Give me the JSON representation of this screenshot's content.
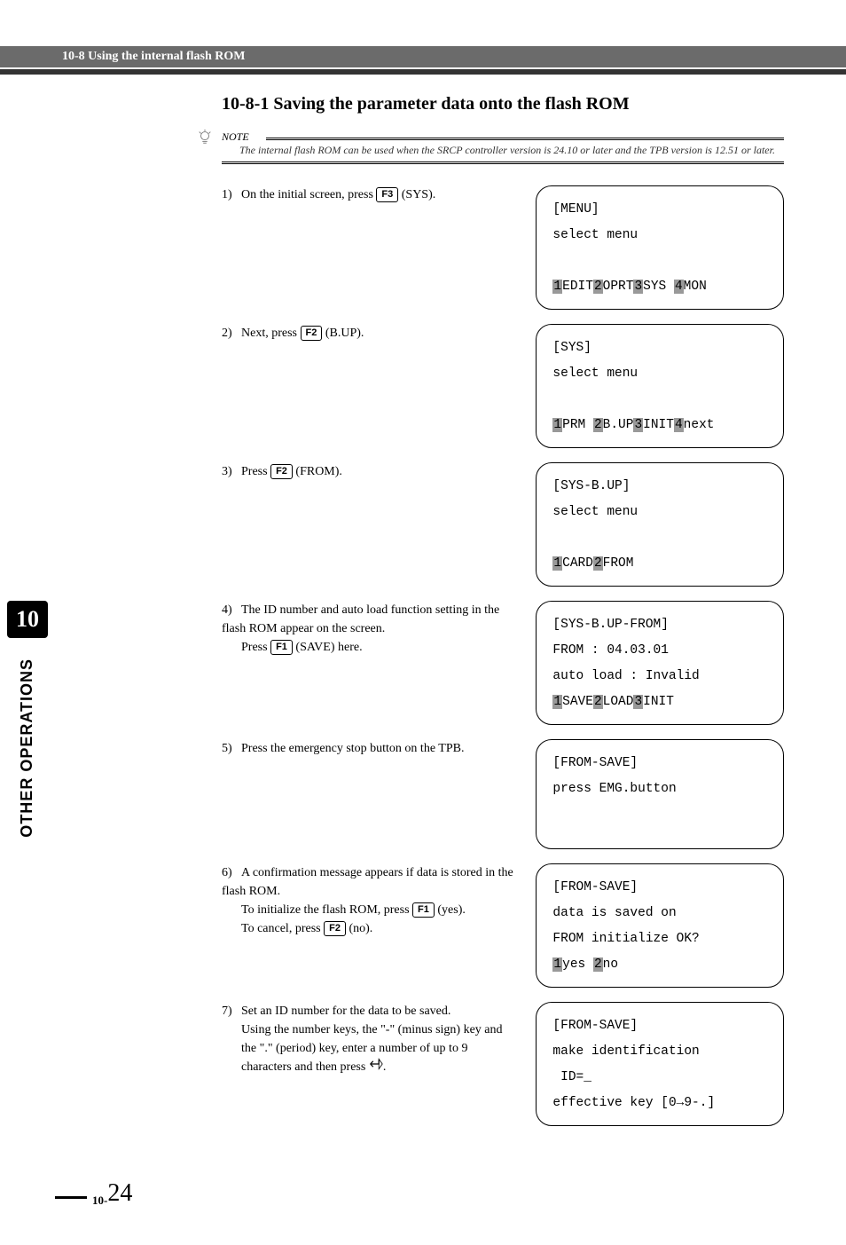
{
  "header": {
    "breadcrumb": "10-8 Using the internal flash ROM"
  },
  "section": {
    "title": "10-8-1 Saving the parameter data onto the flash ROM"
  },
  "note": {
    "label": "NOTE",
    "text": "The internal flash ROM can be used when the SRCP controller version is 24.10 or later and the TPB version is 12.51 or later."
  },
  "steps": [
    {
      "n": "1)",
      "before": "On the initial screen, press ",
      "key": "F3",
      "after": " (SYS)."
    },
    {
      "n": "2)",
      "before": "Next, press ",
      "key": "F2",
      "after": " (B.UP)."
    },
    {
      "n": "3)",
      "before": "Press ",
      "key": "F2",
      "after": " (FROM)."
    },
    {
      "n": "4)",
      "text_a": "The ID number and auto load function setting in the flash ROM appear on the screen.",
      "text_b_before": "Press ",
      "key": "F1",
      "text_b_after": " (SAVE) here."
    },
    {
      "n": "5)",
      "plain": "Press the emergency stop button on the TPB."
    },
    {
      "n": "6)",
      "line1": "A confirmation message appears if data is stored in the flash ROM.",
      "line2_before": "To initialize the flash ROM, press ",
      "key2": "F1",
      "line2_after": " (yes).",
      "line3_before": "To cancel, press ",
      "key3": "F2",
      "line3_after": " (no)."
    },
    {
      "n": "7)",
      "line1": "Set an ID number for the data to be saved.",
      "line2": "Using the number keys, the \"-\" (minus sign) key and the \".\" (period) key, enter a number of up to 9 characters and then press ",
      "enter_icon": true,
      "line2_after": "."
    }
  ],
  "screens": [
    {
      "title": "[MENU]",
      "sub": "select menu",
      "menu": [
        {
          "k": "1",
          "t": "EDIT"
        },
        {
          "k": "2",
          "t": "OPRT"
        },
        {
          "k": "3",
          "t": "SYS "
        },
        {
          "k": "4",
          "t": "MON"
        }
      ]
    },
    {
      "title": "[SYS]",
      "sub": "select menu",
      "menu": [
        {
          "k": "1",
          "t": "PRM "
        },
        {
          "k": "2",
          "t": "B.UP"
        },
        {
          "k": "3",
          "t": "INIT"
        },
        {
          "k": "4",
          "t": "next"
        }
      ]
    },
    {
      "title": "[SYS-B.UP]",
      "sub": "select menu",
      "menu": [
        {
          "k": "1",
          "t": "CARD"
        },
        {
          "k": "2",
          "t": "FROM"
        }
      ]
    },
    {
      "title": "[SYS-B.UP-FROM]",
      "l2": "FROM : 04.03.01",
      "l3": "auto load : Invalid",
      "menu": [
        {
          "k": "1",
          "t": "SAVE"
        },
        {
          "k": "2",
          "t": "LOAD"
        },
        {
          "k": "3",
          "t": "INIT"
        }
      ]
    },
    {
      "title": "[FROM-SAVE]",
      "l2": "press EMG.button"
    },
    {
      "title": "[FROM-SAVE]",
      "l2": "data is saved on",
      "l3": "FROM initialize OK?",
      "menu": [
        {
          "k": "1",
          "t": "yes "
        },
        {
          "k": "2",
          "t": "no"
        }
      ]
    },
    {
      "title": "[FROM-SAVE]",
      "l2": "make identification",
      "l3": " ID=_",
      "l4": "effective key [0→9-.]"
    }
  ],
  "chapter": {
    "num": "10",
    "label": "OTHER OPERATIONS"
  },
  "footer": {
    "prefix": "10-",
    "page": "24"
  }
}
